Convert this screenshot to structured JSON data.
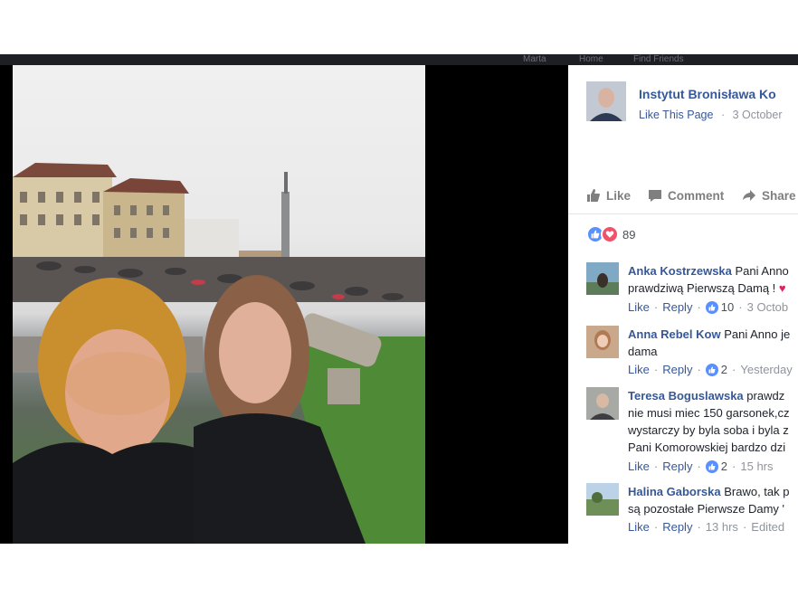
{
  "viewer": {
    "top_strip_items": [
      "Marta",
      "Home",
      "Find Friends"
    ]
  },
  "post": {
    "page_name": "Instytut Bronisława Ko",
    "like_page_label": "Like This Page",
    "date": "3 October",
    "actions": {
      "like": "Like",
      "comment": "Comment",
      "share": "Share"
    },
    "reaction_count": "89"
  },
  "comments": [
    {
      "author": "Anka Kostrzewska",
      "lines": [
        "Pani Anno",
        "prawdziwą Pierwszą Damą !"
      ],
      "like": "Like",
      "reply": "Reply",
      "likes": "10",
      "time": "3 Octob"
    },
    {
      "author": "Anna Rebel Kow",
      "lines": [
        "Pani Anno je",
        "dama"
      ],
      "like": "Like",
      "reply": "Reply",
      "likes": "2",
      "time": "Yesterday"
    },
    {
      "author": "Teresa Boguslawska",
      "lines": [
        "prawdz",
        "nie musi miec 150 garsonek,cz",
        "wystarczy by byla soba i byla z",
        "Pani Komorowskiej bardzo dzi"
      ],
      "like": "Like",
      "reply": "Reply",
      "likes": "2",
      "time": "15 hrs"
    },
    {
      "author": "Halina Gaborska",
      "lines": [
        "Brawo, tak p",
        "są pozostałe Pierwsze Damy '"
      ],
      "like": "Like",
      "reply": "Reply",
      "time": "13 hrs",
      "edited": "Edited"
    }
  ],
  "colors": {
    "link": "#365899",
    "muted": "#90949c",
    "like_blue": "#5890ff",
    "love_red": "#f25268"
  }
}
